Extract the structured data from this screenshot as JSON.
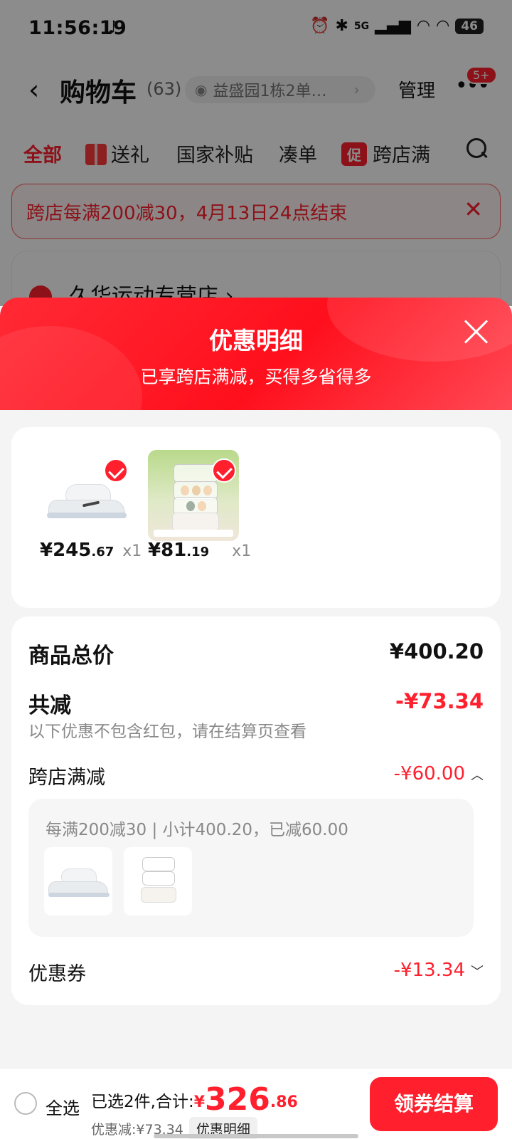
{
  "status_bar": {
    "time": "11:56:19",
    "tiktok_icon": "tiktok-icon",
    "signal": "5G",
    "battery": "46"
  },
  "cart_nav": {
    "title": "购物车",
    "count": "(63)",
    "address": "益盛园1栋2单…",
    "manage": "管理",
    "more_badge": "5+"
  },
  "tabs": [
    {
      "label": "全部"
    },
    {
      "label": "送礼"
    },
    {
      "label": "国家补贴"
    },
    {
      "label": "凑单"
    },
    {
      "label": "跨店满",
      "badge": "促"
    }
  ],
  "promo_banner": {
    "text": "跨店每满200减30，4月13日24点结束",
    "close": "✕"
  },
  "store": {
    "name": "久华运动专营店 ›"
  },
  "sheet": {
    "title": "优惠明细",
    "subtitle": "已享跨店满减，买得多省得多"
  },
  "products": [
    {
      "name": "shoe",
      "price_main": "¥245",
      "price_dec": ".67",
      "qty": "x1"
    },
    {
      "name": "egg-steamer",
      "price_main": "¥81",
      "price_dec": ".19",
      "qty": "x1"
    }
  ],
  "summary": {
    "total_label": "商品总价",
    "total_value": "¥400.20",
    "reduce_label": "共减",
    "reduce_value": "-¥73.34",
    "reduce_hint": "以下优惠不包含红包，请在结算页查看",
    "cross_label": "跨店满减",
    "cross_value": "-¥60.00",
    "cross_rule": "每满200减30 | 小计400.20，已减60.00",
    "coupon_label": "优惠券",
    "coupon_value": "-¥13.34"
  },
  "bottom_bar": {
    "select_all": "全选",
    "selected_prefix": "已选2件,合计:",
    "total_currency": "¥",
    "total_int": "326",
    "total_dec": ".86",
    "discount_text": "优惠减:¥73.34",
    "detail_chip": "优惠明细",
    "checkout": "领券结算"
  },
  "colors": {
    "accent": "#ff1f2d",
    "sheet_gradient_start": "#ff2a35",
    "sheet_gradient_end": "#ff4955"
  }
}
